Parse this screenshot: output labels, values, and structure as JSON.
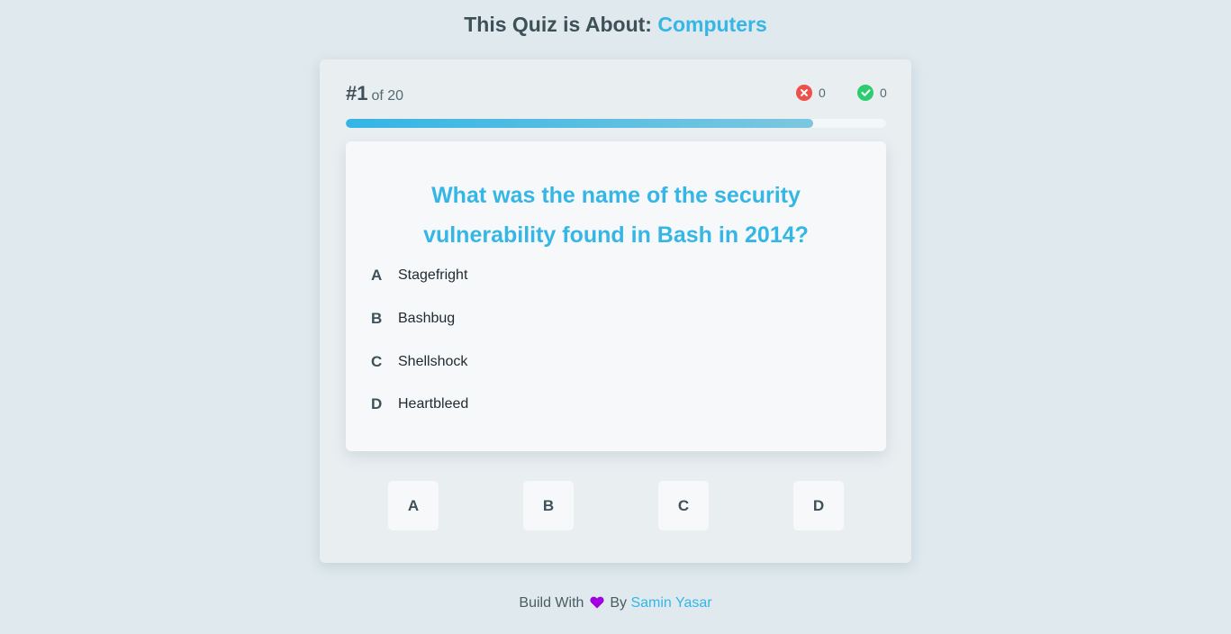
{
  "header": {
    "prefix": "This Quiz is About:",
    "topic": "Computers"
  },
  "status": {
    "number": "#1",
    "of_total": "of 20",
    "wrong_count": "0",
    "correct_count": "0",
    "progress_fraction": 0.865
  },
  "question": {
    "text": "What was the name of the security vulnerability found in Bash in 2014?",
    "options": [
      {
        "letter": "A",
        "text": "Stagefright"
      },
      {
        "letter": "B",
        "text": "Bashbug"
      },
      {
        "letter": "C",
        "text": "Shellshock"
      },
      {
        "letter": "D",
        "text": "Heartbleed"
      }
    ]
  },
  "answer_buttons": [
    "A",
    "B",
    "C",
    "D"
  ],
  "footer": {
    "prefix": "Build With",
    "by": "By",
    "author": "Samin Yasar"
  },
  "colors": {
    "accent": "#35b6e6",
    "wrong": "#f0504a",
    "correct": "#2ecc71",
    "heart": "#a100e0"
  },
  "icons": [
    "close-circle-icon",
    "check-circle-icon",
    "heart-icon"
  ]
}
